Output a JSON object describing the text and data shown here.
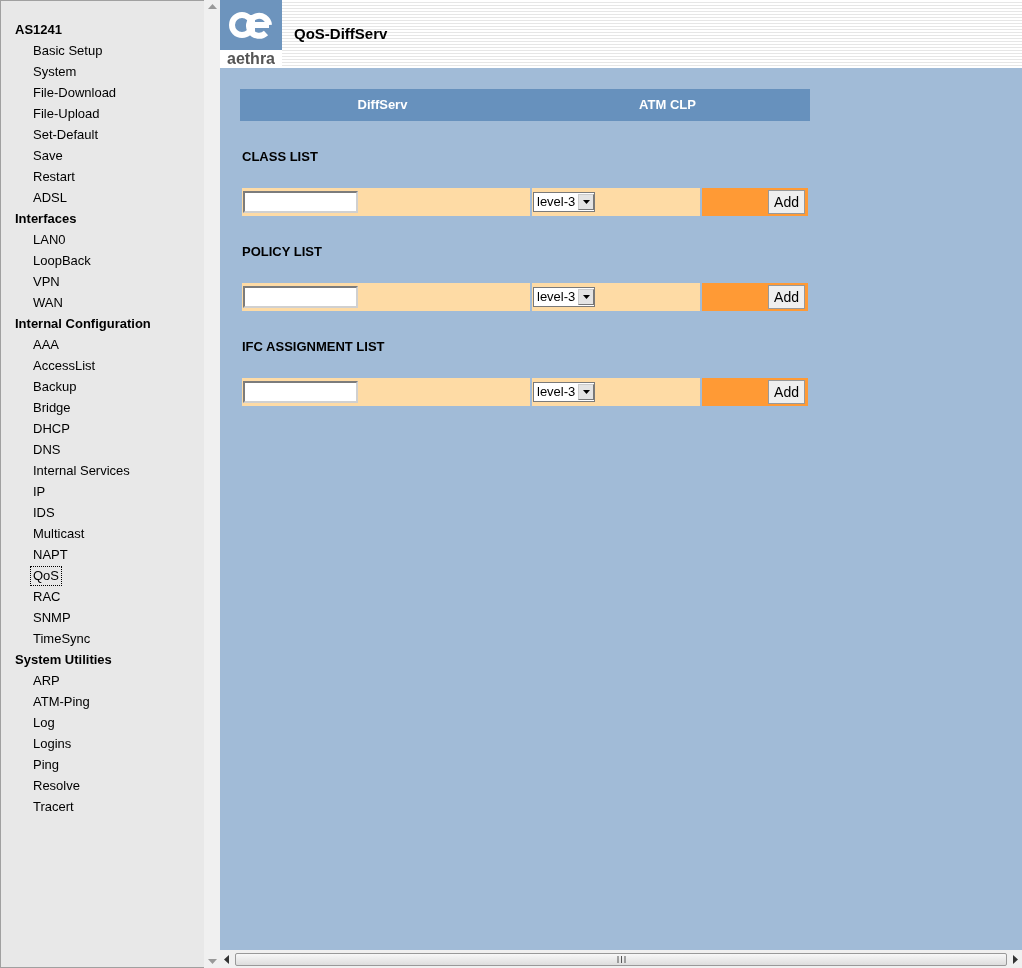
{
  "sidebar": {
    "groups": [
      {
        "title": "AS1241",
        "items": [
          {
            "label": "Basic Setup",
            "selected": false
          },
          {
            "label": "System",
            "selected": false
          },
          {
            "label": "File-Download",
            "selected": false
          },
          {
            "label": "File-Upload",
            "selected": false
          },
          {
            "label": "Set-Default",
            "selected": false
          },
          {
            "label": "Save",
            "selected": false
          },
          {
            "label": "Restart",
            "selected": false
          },
          {
            "label": "ADSL",
            "selected": false
          }
        ]
      },
      {
        "title": "Interfaces",
        "items": [
          {
            "label": "LAN0",
            "selected": false
          },
          {
            "label": "LoopBack",
            "selected": false
          },
          {
            "label": "VPN",
            "selected": false
          },
          {
            "label": "WAN",
            "selected": false
          }
        ]
      },
      {
        "title": "Internal Configuration",
        "items": [
          {
            "label": "AAA",
            "selected": false
          },
          {
            "label": "AccessList",
            "selected": false
          },
          {
            "label": "Backup",
            "selected": false
          },
          {
            "label": "Bridge",
            "selected": false
          },
          {
            "label": "DHCP",
            "selected": false
          },
          {
            "label": "DNS",
            "selected": false
          },
          {
            "label": "Internal Services",
            "selected": false
          },
          {
            "label": "IP",
            "selected": false
          },
          {
            "label": "IDS",
            "selected": false
          },
          {
            "label": "Multicast",
            "selected": false
          },
          {
            "label": "NAPT",
            "selected": false
          },
          {
            "label": "QoS",
            "selected": true
          },
          {
            "label": "RAC",
            "selected": false
          },
          {
            "label": "SNMP",
            "selected": false
          },
          {
            "label": "TimeSync",
            "selected": false
          }
        ]
      },
      {
        "title": "System Utilities",
        "items": [
          {
            "label": "ARP",
            "selected": false
          },
          {
            "label": "ATM-Ping",
            "selected": false
          },
          {
            "label": "Log",
            "selected": false
          },
          {
            "label": "Logins",
            "selected": false
          },
          {
            "label": "Ping",
            "selected": false
          },
          {
            "label": "Resolve",
            "selected": false
          },
          {
            "label": "Tracert",
            "selected": false
          }
        ]
      }
    ]
  },
  "header": {
    "logo_text": "aethra",
    "title": "QoS-DiffServ"
  },
  "tabs": [
    {
      "label": "DiffServ"
    },
    {
      "label": "ATM CLP"
    }
  ],
  "sections": [
    {
      "title": "CLASS LIST",
      "select_value": "level-3",
      "button": "Add"
    },
    {
      "title": "POLICY LIST",
      "select_value": "level-3",
      "button": "Add"
    },
    {
      "title": "IFC ASSIGNMENT LIST",
      "select_value": "level-3",
      "button": "Add"
    }
  ]
}
